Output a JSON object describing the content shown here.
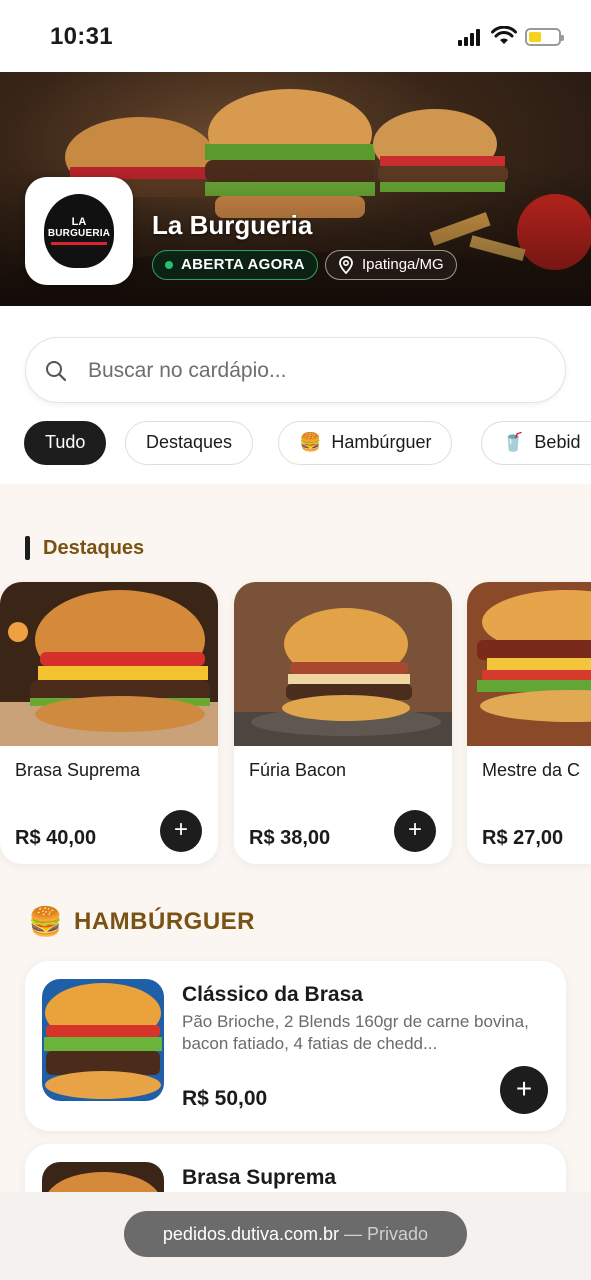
{
  "status_bar": {
    "time": "10:31"
  },
  "store": {
    "name": "La Burgueria",
    "logo_line1": "LA",
    "logo_line2": "BURGUERIA",
    "status": "ABERTA AGORA",
    "location": "Ipatinga/MG"
  },
  "search": {
    "placeholder": "Buscar no cardápio..."
  },
  "categories": [
    {
      "label": "Tudo",
      "icon": "",
      "active": true
    },
    {
      "label": "Destaques",
      "icon": ""
    },
    {
      "label": "Hambúrguer",
      "icon": "🍔"
    },
    {
      "label": "Bebid",
      "icon": "🥤"
    }
  ],
  "highlights": {
    "title": "Destaques",
    "items": [
      {
        "name": "Brasa Suprema",
        "price": "R$ 40,00"
      },
      {
        "name": "Fúria Bacon",
        "price": "R$ 38,00"
      },
      {
        "name": "Mestre da C",
        "price": "R$ 27,00"
      }
    ]
  },
  "category_section": {
    "icon": "🍔",
    "title": "HAMBÚRGUER",
    "items": [
      {
        "name": "Clássico da Brasa",
        "description": "Pão Brioche, 2 Blends 160gr de carne bovina, bacon fatiado, 4 fatias de chedd...",
        "price": "R$ 50,00"
      },
      {
        "name": "Brasa Suprema"
      }
    ]
  },
  "browser": {
    "url": "pedidos.dutiva.com.br",
    "mode": "— Privado"
  },
  "colors": {
    "accent": "#7a5214",
    "dark": "#1d1d1d",
    "open_green": "#25c26a"
  }
}
